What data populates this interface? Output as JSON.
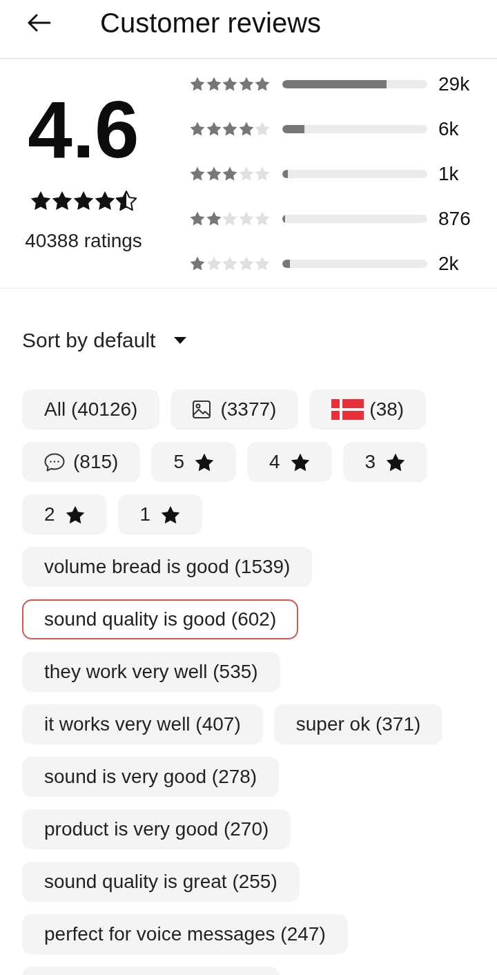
{
  "header": {
    "title": "Customer reviews"
  },
  "summary": {
    "average": "4.6",
    "stars": 4.5,
    "ratings": "40388 ratings"
  },
  "distribution": [
    {
      "stars": 5,
      "level": 0.72,
      "count": "29k"
    },
    {
      "stars": 4,
      "level": 0.15,
      "count": "6k"
    },
    {
      "stars": 3,
      "level": 0.04,
      "count": "1k"
    },
    {
      "stars": 2,
      "level": 0.02,
      "count": "876"
    },
    {
      "stars": 1,
      "level": 0.05,
      "count": "2k"
    }
  ],
  "sort": {
    "label": "Sort by default"
  },
  "filters": [
    {
      "kind": "all",
      "label": "All (40126)",
      "selected": false
    },
    {
      "kind": "photo",
      "label": "(3377)",
      "selected": false
    },
    {
      "kind": "country",
      "label": "(38)",
      "selected": false
    },
    {
      "kind": "comment",
      "label": "(815)",
      "selected": false
    },
    {
      "kind": "rating",
      "label": "5",
      "selected": false
    },
    {
      "kind": "rating",
      "label": "4",
      "selected": false
    },
    {
      "kind": "rating",
      "label": "3",
      "selected": false
    },
    {
      "kind": "rating",
      "label": "2",
      "selected": false
    },
    {
      "kind": "rating",
      "label": "1",
      "selected": false
    },
    {
      "kind": "tag",
      "label": "volume bread is good (1539)",
      "selected": false
    },
    {
      "kind": "tag",
      "label": "sound quality is good (602)",
      "selected": true
    },
    {
      "kind": "tag",
      "label": "they work very well (535)",
      "selected": false
    },
    {
      "kind": "tag",
      "label": "it works very well (407)",
      "selected": false
    },
    {
      "kind": "tag",
      "label": "super ok (371)",
      "selected": false
    },
    {
      "kind": "tag",
      "label": "sound is very good (278)",
      "selected": false
    },
    {
      "kind": "tag",
      "label": "product is very good (270)",
      "selected": false
    },
    {
      "kind": "tag",
      "label": "sound quality is great (255)",
      "selected": false
    },
    {
      "kind": "tag",
      "label": "perfect for voice messages (247)",
      "selected": false
    }
  ],
  "more_below": true
}
